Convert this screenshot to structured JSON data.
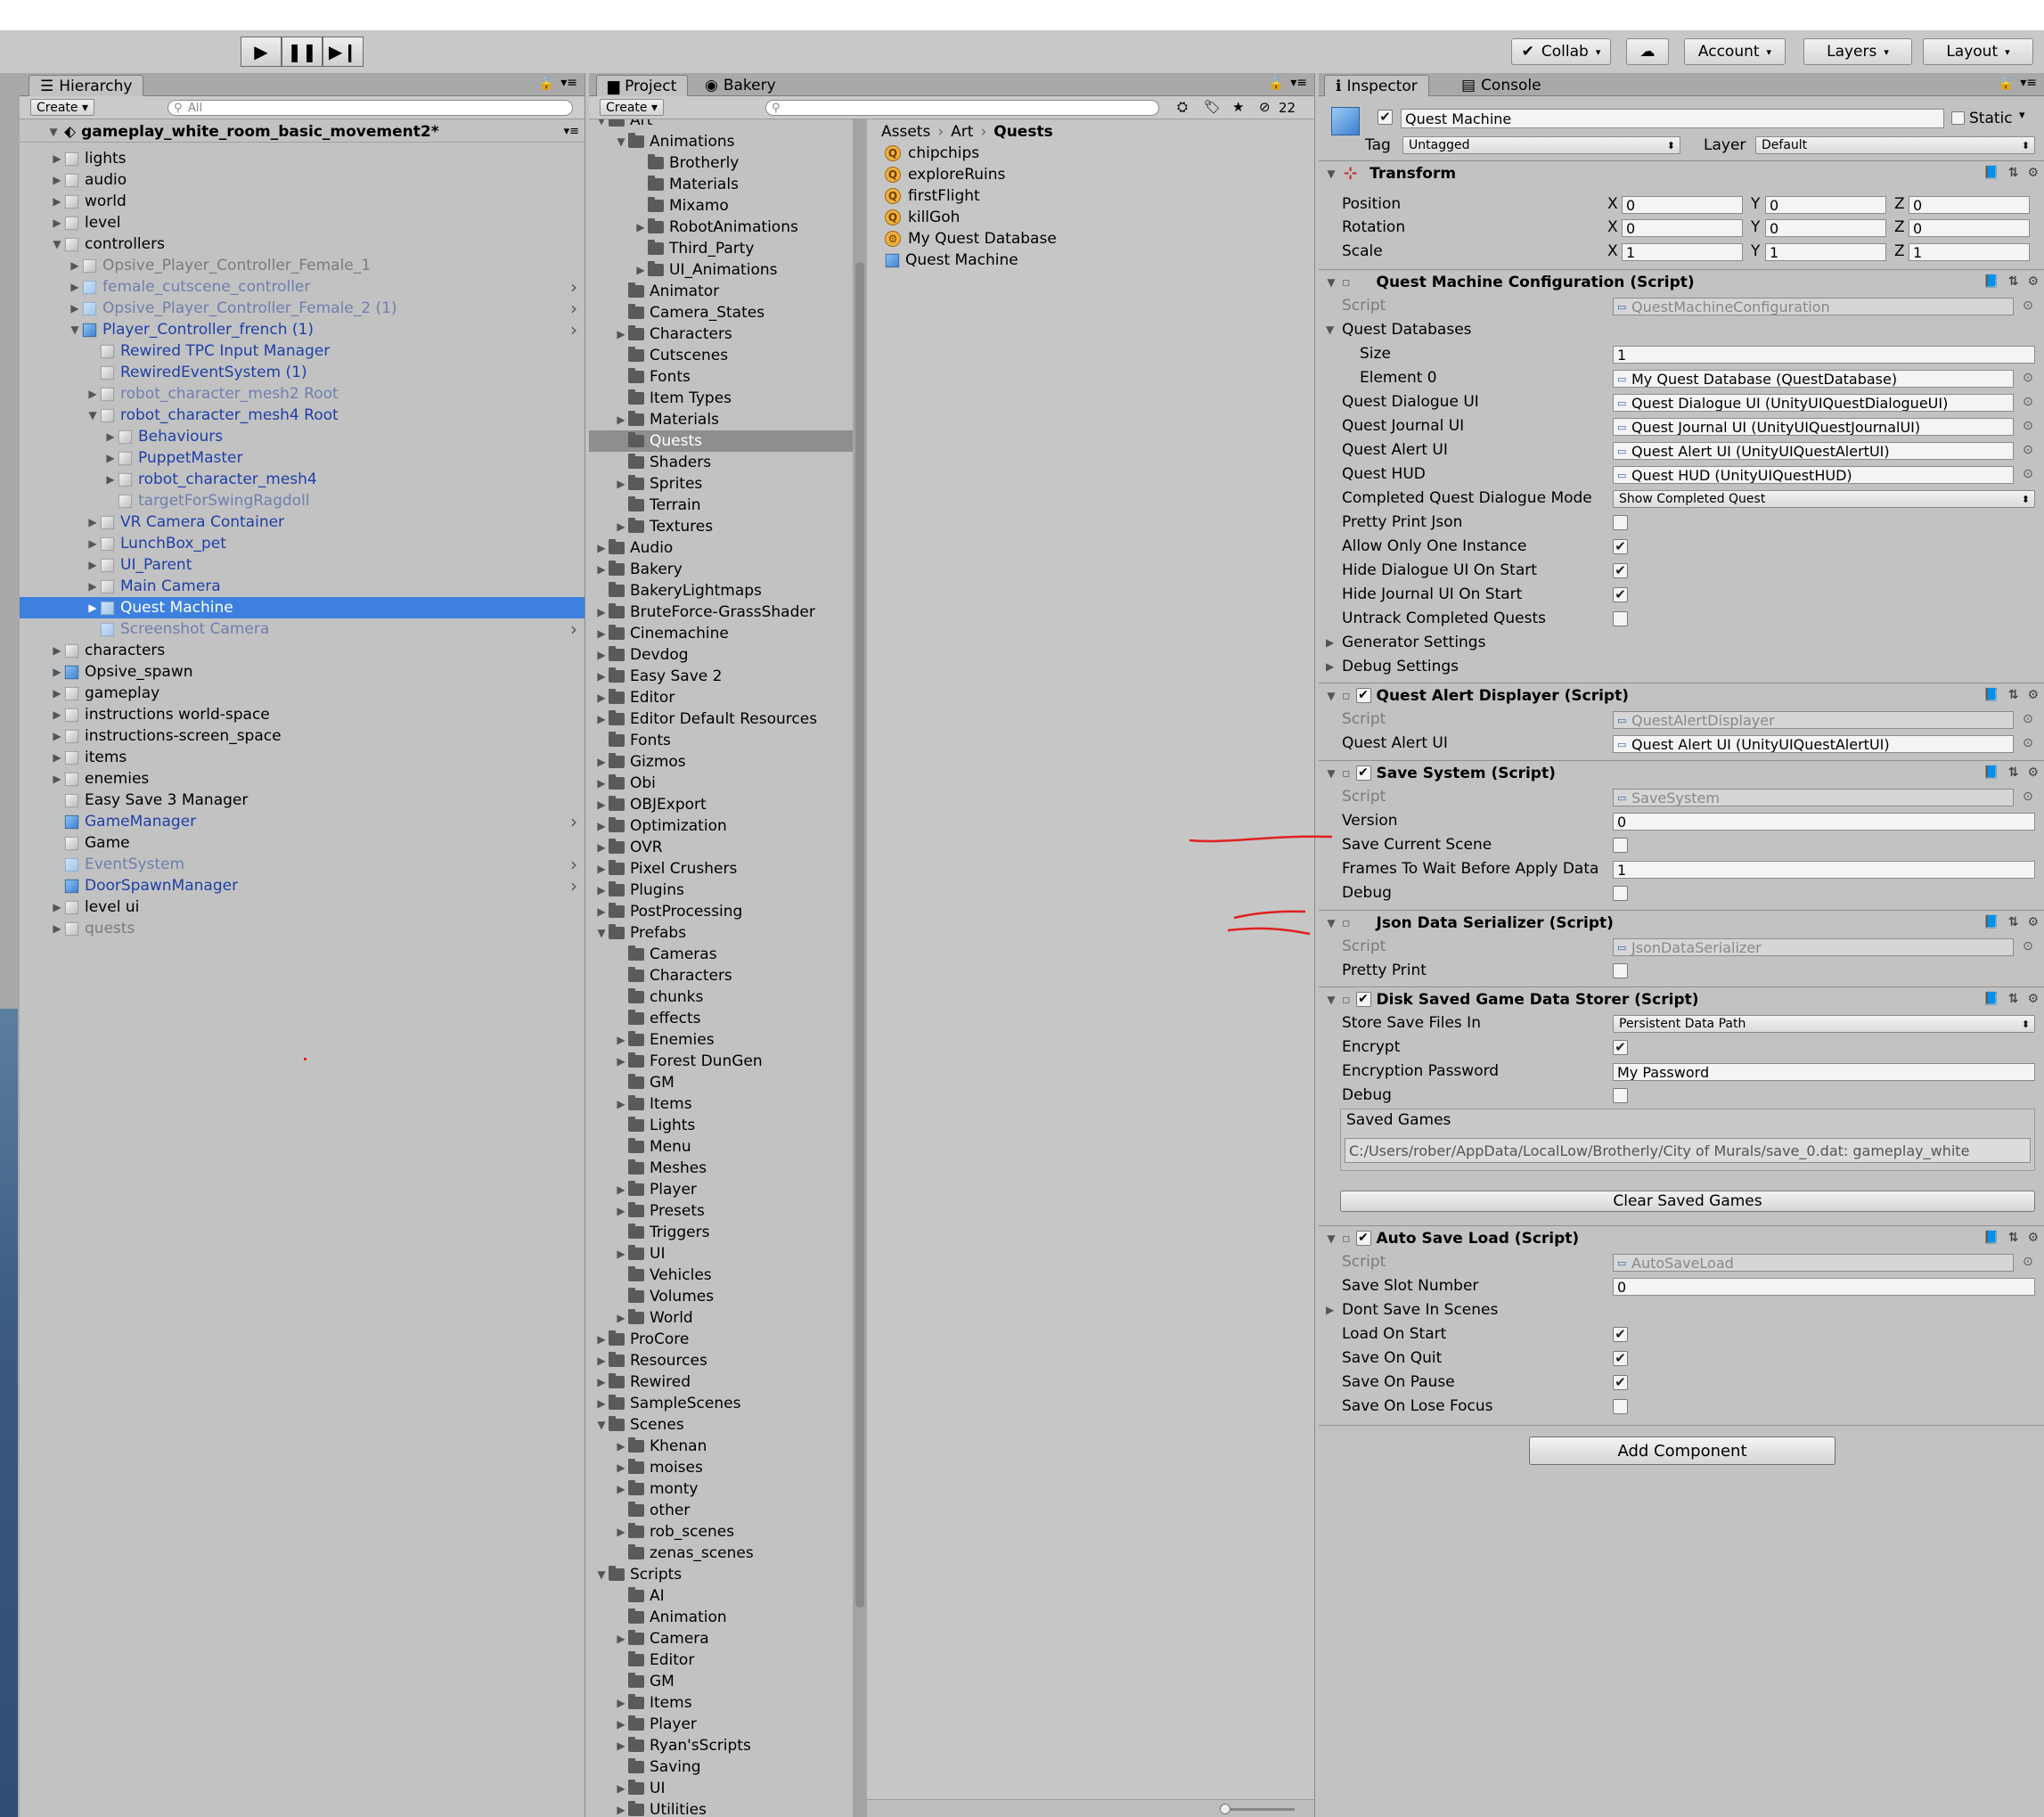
{
  "toolbar": {
    "collab": "Collab",
    "account": "Account",
    "layers": "Layers",
    "layout": "Layout"
  },
  "hierarchy": {
    "tab": "Hierarchy",
    "create": "Create",
    "search_placeholder": "All",
    "scene": "gameplay_white_room_basic_movement2*",
    "items": [
      {
        "label": "lights",
        "indent": 1,
        "arrow": "▶",
        "icon": "grey",
        "style": ""
      },
      {
        "label": "audio",
        "indent": 1,
        "arrow": "▶",
        "icon": "grey",
        "style": ""
      },
      {
        "label": "world",
        "indent": 1,
        "arrow": "▶",
        "icon": "grey",
        "style": ""
      },
      {
        "label": "level",
        "indent": 1,
        "arrow": "▶",
        "icon": "grey",
        "style": ""
      },
      {
        "label": "controllers",
        "indent": 1,
        "arrow": "▼",
        "icon": "grey",
        "style": ""
      },
      {
        "label": "Opsive_Player_Controller_Female_1",
        "indent": 2,
        "arrow": "▶",
        "icon": "grey",
        "style": "dim"
      },
      {
        "label": "female_cutscene_controller",
        "indent": 2,
        "arrow": "▶",
        "icon": "pale",
        "style": "dimblue",
        "more": true
      },
      {
        "label": "Opsive_Player_Controller_Female_2 (1)",
        "indent": 2,
        "arrow": "▶",
        "icon": "pale",
        "style": "dimblue",
        "more": true
      },
      {
        "label": "Player_Controller_french (1)",
        "indent": 2,
        "arrow": "▼",
        "icon": "blue",
        "style": "prefab",
        "more": true
      },
      {
        "label": "Rewired TPC Input Manager",
        "indent": 3,
        "arrow": "",
        "icon": "grey",
        "style": "prefab"
      },
      {
        "label": "RewiredEventSystem (1)",
        "indent": 3,
        "arrow": "",
        "icon": "grey",
        "style": "prefab"
      },
      {
        "label": "robot_character_mesh2 Root",
        "indent": 3,
        "arrow": "▶",
        "icon": "grey",
        "style": "dimblue"
      },
      {
        "label": "robot_character_mesh4 Root",
        "indent": 3,
        "arrow": "▼",
        "icon": "grey",
        "style": "prefab"
      },
      {
        "label": "Behaviours",
        "indent": 4,
        "arrow": "▶",
        "icon": "grey",
        "style": "prefab"
      },
      {
        "label": "PuppetMaster",
        "indent": 4,
        "arrow": "▶",
        "icon": "grey",
        "style": "prefab"
      },
      {
        "label": "robot_character_mesh4",
        "indent": 4,
        "arrow": "▶",
        "icon": "grey",
        "style": "prefab"
      },
      {
        "label": "targetForSwingRagdoll",
        "indent": 4,
        "arrow": "",
        "icon": "grey",
        "style": "dimblue"
      },
      {
        "label": "VR Camera Container",
        "indent": 3,
        "arrow": "▶",
        "icon": "grey",
        "style": "prefab"
      },
      {
        "label": "LunchBox_pet",
        "indent": 3,
        "arrow": "▶",
        "icon": "grey",
        "style": "prefab"
      },
      {
        "label": "UI_Parent",
        "indent": 3,
        "arrow": "▶",
        "icon": "grey",
        "style": "prefab"
      },
      {
        "label": "Main Camera",
        "indent": 3,
        "arrow": "▶",
        "icon": "grey",
        "style": "prefab"
      },
      {
        "label": "Quest Machine",
        "indent": 3,
        "arrow": "▶",
        "icon": "pale",
        "style": "sel"
      },
      {
        "label": "Screenshot Camera",
        "indent": 3,
        "arrow": "",
        "icon": "pale",
        "style": "dimblue",
        "more": true
      },
      {
        "label": "characters",
        "indent": 1,
        "arrow": "▶",
        "icon": "grey",
        "style": ""
      },
      {
        "label": "Opsive_spawn",
        "indent": 1,
        "arrow": "▶",
        "icon": "blue",
        "style": ""
      },
      {
        "label": "gameplay",
        "indent": 1,
        "arrow": "▶",
        "icon": "grey",
        "style": ""
      },
      {
        "label": "instructions world-space",
        "indent": 1,
        "arrow": "▶",
        "icon": "grey",
        "style": ""
      },
      {
        "label": "instructions-screen_space",
        "indent": 1,
        "arrow": "▶",
        "icon": "grey",
        "style": ""
      },
      {
        "label": "items",
        "indent": 1,
        "arrow": "▶",
        "icon": "grey",
        "style": ""
      },
      {
        "label": "enemies",
        "indent": 1,
        "arrow": "▶",
        "icon": "grey",
        "style": ""
      },
      {
        "label": "Easy Save 3 Manager",
        "indent": 1,
        "arrow": "",
        "icon": "grey",
        "style": ""
      },
      {
        "label": "GameManager",
        "indent": 1,
        "arrow": "",
        "icon": "blue",
        "style": "prefab",
        "more": true
      },
      {
        "label": "Game",
        "indent": 1,
        "arrow": "",
        "icon": "grey",
        "style": ""
      },
      {
        "label": "EventSystem",
        "indent": 1,
        "arrow": "",
        "icon": "pale",
        "style": "dimblue",
        "more": true
      },
      {
        "label": "DoorSpawnManager",
        "indent": 1,
        "arrow": "",
        "icon": "blue",
        "style": "prefab",
        "more": true
      },
      {
        "label": "level ui",
        "indent": 1,
        "arrow": "▶",
        "icon": "grey",
        "style": ""
      },
      {
        "label": "quests",
        "indent": 1,
        "arrow": "▶",
        "icon": "grey",
        "style": "dim"
      }
    ]
  },
  "project": {
    "tab": "Project",
    "tab2": "Bakery",
    "create": "Create",
    "hidden_count": "22",
    "tree": [
      {
        "label": "Art",
        "indent": 1,
        "arrow": "▼"
      },
      {
        "label": "Animations",
        "indent": 2,
        "arrow": "▼"
      },
      {
        "label": "Brotherly",
        "indent": 3,
        "arrow": ""
      },
      {
        "label": "Materials",
        "indent": 3,
        "arrow": ""
      },
      {
        "label": "Mixamo",
        "indent": 3,
        "arrow": ""
      },
      {
        "label": "RobotAnimations",
        "indent": 3,
        "arrow": "▶"
      },
      {
        "label": "Third_Party",
        "indent": 3,
        "arrow": ""
      },
      {
        "label": "UI_Animations",
        "indent": 3,
        "arrow": "▶"
      },
      {
        "label": "Animator",
        "indent": 2,
        "arrow": ""
      },
      {
        "label": "Camera_States",
        "indent": 2,
        "arrow": ""
      },
      {
        "label": "Characters",
        "indent": 2,
        "arrow": "▶"
      },
      {
        "label": "Cutscenes",
        "indent": 2,
        "arrow": ""
      },
      {
        "label": "Fonts",
        "indent": 2,
        "arrow": ""
      },
      {
        "label": "Item Types",
        "indent": 2,
        "arrow": ""
      },
      {
        "label": "Materials",
        "indent": 2,
        "arrow": "▶"
      },
      {
        "label": "Quests",
        "indent": 2,
        "arrow": "",
        "sel": true
      },
      {
        "label": "Shaders",
        "indent": 2,
        "arrow": ""
      },
      {
        "label": "Sprites",
        "indent": 2,
        "arrow": "▶"
      },
      {
        "label": "Terrain",
        "indent": 2,
        "arrow": ""
      },
      {
        "label": "Textures",
        "indent": 2,
        "arrow": "▶"
      },
      {
        "label": "Audio",
        "indent": 1,
        "arrow": "▶"
      },
      {
        "label": "Bakery",
        "indent": 1,
        "arrow": "▶"
      },
      {
        "label": "BakeryLightmaps",
        "indent": 1,
        "arrow": ""
      },
      {
        "label": "BruteForce-GrassShader",
        "indent": 1,
        "arrow": "▶"
      },
      {
        "label": "Cinemachine",
        "indent": 1,
        "arrow": "▶"
      },
      {
        "label": "Devdog",
        "indent": 1,
        "arrow": "▶"
      },
      {
        "label": "Easy Save 2",
        "indent": 1,
        "arrow": "▶"
      },
      {
        "label": "Editor",
        "indent": 1,
        "arrow": "▶"
      },
      {
        "label": "Editor Default Resources",
        "indent": 1,
        "arrow": "▶"
      },
      {
        "label": "Fonts",
        "indent": 1,
        "arrow": ""
      },
      {
        "label": "Gizmos",
        "indent": 1,
        "arrow": "▶"
      },
      {
        "label": "Obi",
        "indent": 1,
        "arrow": "▶"
      },
      {
        "label": "OBJExport",
        "indent": 1,
        "arrow": "▶"
      },
      {
        "label": "Optimization",
        "indent": 1,
        "arrow": "▶"
      },
      {
        "label": "OVR",
        "indent": 1,
        "arrow": "▶"
      },
      {
        "label": "Pixel Crushers",
        "indent": 1,
        "arrow": "▶"
      },
      {
        "label": "Plugins",
        "indent": 1,
        "arrow": "▶"
      },
      {
        "label": "PostProcessing",
        "indent": 1,
        "arrow": "▶"
      },
      {
        "label": "Prefabs",
        "indent": 1,
        "arrow": "▼"
      },
      {
        "label": "Cameras",
        "indent": 2,
        "arrow": ""
      },
      {
        "label": "Characters",
        "indent": 2,
        "arrow": ""
      },
      {
        "label": "chunks",
        "indent": 2,
        "arrow": ""
      },
      {
        "label": "effects",
        "indent": 2,
        "arrow": ""
      },
      {
        "label": "Enemies",
        "indent": 2,
        "arrow": "▶"
      },
      {
        "label": "Forest DunGen",
        "indent": 2,
        "arrow": "▶"
      },
      {
        "label": "GM",
        "indent": 2,
        "arrow": ""
      },
      {
        "label": "Items",
        "indent": 2,
        "arrow": "▶"
      },
      {
        "label": "Lights",
        "indent": 2,
        "arrow": ""
      },
      {
        "label": "Menu",
        "indent": 2,
        "arrow": ""
      },
      {
        "label": "Meshes",
        "indent": 2,
        "arrow": ""
      },
      {
        "label": "Player",
        "indent": 2,
        "arrow": "▶"
      },
      {
        "label": "Presets",
        "indent": 2,
        "arrow": "▶"
      },
      {
        "label": "Triggers",
        "indent": 2,
        "arrow": ""
      },
      {
        "label": "UI",
        "indent": 2,
        "arrow": "▶"
      },
      {
        "label": "Vehicles",
        "indent": 2,
        "arrow": ""
      },
      {
        "label": "Volumes",
        "indent": 2,
        "arrow": ""
      },
      {
        "label": "World",
        "indent": 2,
        "arrow": "▶"
      },
      {
        "label": "ProCore",
        "indent": 1,
        "arrow": "▶"
      },
      {
        "label": "Resources",
        "indent": 1,
        "arrow": "▶"
      },
      {
        "label": "Rewired",
        "indent": 1,
        "arrow": "▶"
      },
      {
        "label": "SampleScenes",
        "indent": 1,
        "arrow": "▶"
      },
      {
        "label": "Scenes",
        "indent": 1,
        "arrow": "▼"
      },
      {
        "label": "Khenan",
        "indent": 2,
        "arrow": "▶"
      },
      {
        "label": "moises",
        "indent": 2,
        "arrow": "▶"
      },
      {
        "label": "monty",
        "indent": 2,
        "arrow": "▶"
      },
      {
        "label": "other",
        "indent": 2,
        "arrow": ""
      },
      {
        "label": "rob_scenes",
        "indent": 2,
        "arrow": "▶"
      },
      {
        "label": "zenas_scenes",
        "indent": 2,
        "arrow": ""
      },
      {
        "label": "Scripts",
        "indent": 1,
        "arrow": "▼"
      },
      {
        "label": "AI",
        "indent": 2,
        "arrow": ""
      },
      {
        "label": "Animation",
        "indent": 2,
        "arrow": ""
      },
      {
        "label": "Camera",
        "indent": 2,
        "arrow": "▶"
      },
      {
        "label": "Editor",
        "indent": 2,
        "arrow": ""
      },
      {
        "label": "GM",
        "indent": 2,
        "arrow": ""
      },
      {
        "label": "Items",
        "indent": 2,
        "arrow": "▶"
      },
      {
        "label": "Player",
        "indent": 2,
        "arrow": "▶"
      },
      {
        "label": "Ryan'sScripts",
        "indent": 2,
        "arrow": "▶"
      },
      {
        "label": "Saving",
        "indent": 2,
        "arrow": ""
      },
      {
        "label": "UI",
        "indent": 2,
        "arrow": "▶"
      },
      {
        "label": "Utilities",
        "indent": 2,
        "arrow": "▶"
      }
    ],
    "breadcrumb": [
      "Assets",
      "Art",
      "Quests"
    ],
    "assets": [
      {
        "label": "chipchips",
        "icon": "quest-icon"
      },
      {
        "label": "exploreRuins",
        "icon": "quest-icon"
      },
      {
        "label": "firstFlight",
        "icon": "quest-icon"
      },
      {
        "label": "killGoh",
        "icon": "quest-icon"
      },
      {
        "label": "My Quest Database",
        "icon": "database-icon"
      },
      {
        "label": "Quest Machine",
        "icon": "prefab-icon"
      }
    ]
  },
  "inspector": {
    "tab": "Inspector",
    "tab2": "Console",
    "object_name": "Quest Machine",
    "static": "Static",
    "tag_label": "Tag",
    "tag": "Untagged",
    "layer_label": "Layer",
    "layer": "Default",
    "transform": {
      "title": "Transform",
      "position": "Position",
      "rotation": "Rotation",
      "scale": "Scale",
      "pos": [
        "0",
        "0",
        "0"
      ],
      "rot": [
        "0",
        "0",
        "0"
      ],
      "scl": [
        "1",
        "1",
        "1"
      ]
    },
    "qmc": {
      "title": "Quest Machine Configuration (Script)",
      "script_label": "Script",
      "script": "QuestMachineConfiguration",
      "databases": "Quest Databases",
      "size_label": "Size",
      "size": "1",
      "element0_label": "Element 0",
      "element0": "My Quest Database (QuestDatabase)",
      "dialogue_label": "Quest Dialogue UI",
      "dialogue": "Quest Dialogue UI (UnityUIQuestDialogueUI)",
      "journal_label": "Quest Journal UI",
      "journal": "Quest Journal UI (UnityUIQuestJournalUI)",
      "alert_label": "Quest Alert UI",
      "alert": "Quest Alert UI (UnityUIQuestAlertUI)",
      "hud_label": "Quest HUD",
      "hud": "Quest HUD (UnityUIQuestHUD)",
      "mode_label": "Completed Quest Dialogue Mode",
      "mode": "Show Completed Quest",
      "pretty_label": "Pretty Print Json",
      "pretty": false,
      "one_label": "Allow Only One Instance",
      "one": true,
      "hidedlg_label": "Hide Dialogue UI On Start",
      "hidedlg": true,
      "hidejrn_label": "Hide Journal UI On Start",
      "hidejrn": true,
      "untrack_label": "Untrack Completed Quests",
      "untrack": false,
      "gen_label": "Generator Settings",
      "debug_label": "Debug Settings"
    },
    "qad": {
      "title": "Quest Alert Displayer (Script)",
      "script_label": "Script",
      "script": "QuestAlertDisplayer",
      "alert_label": "Quest Alert UI",
      "alert": "Quest Alert UI (UnityUIQuestAlertUI)"
    },
    "save": {
      "title": "Save System (Script)",
      "script_label": "Script",
      "script": "SaveSystem",
      "version_label": "Version",
      "version": "0",
      "scene_label": "Save Current Scene",
      "scene": false,
      "frames_label": "Frames To Wait Before Apply Data",
      "frames": "1",
      "debug_label": "Debug",
      "debug": false
    },
    "json": {
      "title": "Json Data Serializer (Script)",
      "script_label": "Script",
      "script": "JsonDataSerializer",
      "pretty_label": "Pretty Print",
      "pretty": false
    },
    "disk": {
      "title": "Disk Saved Game Data Storer (Script)",
      "store_label": "Store Save Files In",
      "store": "Persistent Data Path",
      "encrypt_label": "Encrypt",
      "encrypt": true,
      "pwd_label": "Encryption Password",
      "pwd": "My Password",
      "debug_label": "Debug",
      "debug": false,
      "saved_label": "Saved Games",
      "saved_path": "C:/Users/rober/AppData/LocalLow/Brotherly/City of Murals/save_0.dat: gameplay_white",
      "clear": "Clear Saved Games"
    },
    "auto": {
      "title": "Auto Save Load (Script)",
      "script_label": "Script",
      "script": "AutoSaveLoad",
      "slot_label": "Save Slot Number",
      "slot": "0",
      "dont_label": "Dont Save In Scenes",
      "load_label": "Load On Start",
      "load": true,
      "quit_label": "Save On Quit",
      "quit": true,
      "pause_label": "Save On Pause",
      "pause": true,
      "lose_label": "Save On Lose Focus",
      "lose": false
    },
    "add": "Add Component"
  },
  "annotation_color": "#e02020"
}
